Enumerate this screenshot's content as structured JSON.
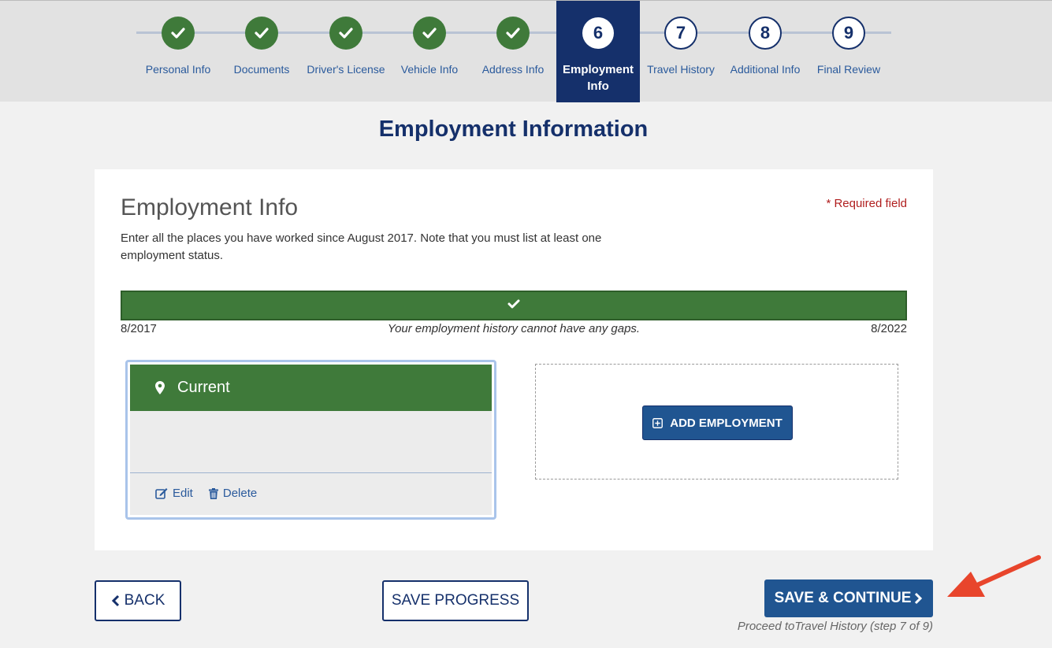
{
  "stepper": {
    "steps": [
      {
        "number": "1",
        "label": "Personal Info",
        "state": "done"
      },
      {
        "number": "2",
        "label": "Documents",
        "state": "done"
      },
      {
        "number": "3",
        "label": "Driver's License",
        "state": "done"
      },
      {
        "number": "4",
        "label": "Vehicle Info",
        "state": "done"
      },
      {
        "number": "5",
        "label": "Address Info",
        "state": "done"
      },
      {
        "number": "6",
        "label": "Employment Info",
        "state": "active"
      },
      {
        "number": "7",
        "label": "Travel History",
        "state": "future"
      },
      {
        "number": "8",
        "label": "Additional Info",
        "state": "future"
      },
      {
        "number": "9",
        "label": "Final Review",
        "state": "future"
      }
    ]
  },
  "page_title": "Employment Information",
  "card": {
    "title": "Employment Info",
    "required_note": "* Required field",
    "description": "Enter all the places you have worked since August 2017. Note that you must list at least one employment status."
  },
  "timeline": {
    "start": "8/2017",
    "end": "8/2022",
    "note": "Your employment history cannot have any gaps.",
    "filled_fraction": 1.0
  },
  "employment": {
    "status": "Current",
    "edit_label": "Edit",
    "delete_label": "Delete"
  },
  "add_employment_label": "ADD EMPLOYMENT",
  "footer": {
    "back_label": "BACK",
    "save_progress_label": "SAVE PROGRESS",
    "save_continue_label": "SAVE & CONTINUE",
    "proceed_note": "Proceed toTravel History (step 7 of 9)"
  },
  "colors": {
    "navy": "#15306b",
    "button_blue": "#205591",
    "success_green": "#3f7a3a",
    "required_red": "#b01e1e",
    "annotation_arrow": "#e8452c"
  }
}
